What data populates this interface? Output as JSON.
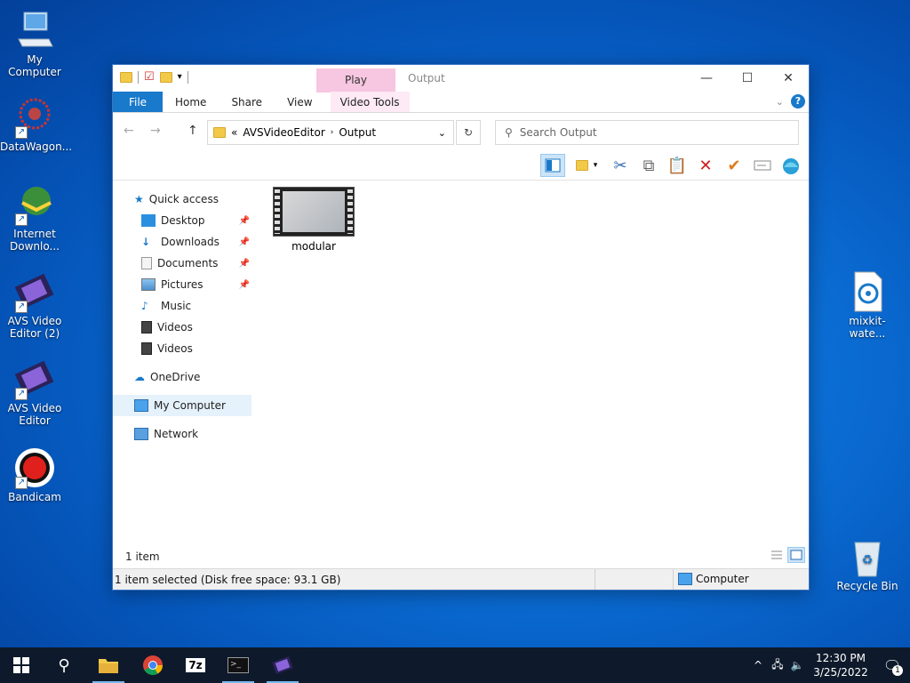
{
  "desktop": {
    "icons": [
      {
        "label": "My Computer"
      },
      {
        "label": "DataWagon..."
      },
      {
        "label": "Internet Downlo..."
      },
      {
        "label": "AVS Video Editor (2)"
      },
      {
        "label": "AVS Video Editor"
      },
      {
        "label": "Bandicam"
      },
      {
        "label": "mixkit-wate..."
      },
      {
        "label": "Recycle Bin"
      }
    ]
  },
  "window": {
    "title": "Output",
    "context_tab": "Play",
    "tabs": {
      "file": "File",
      "home": "Home",
      "share": "Share",
      "view": "View",
      "video_tools": "Video Tools"
    },
    "help": "?",
    "address": {
      "chevrons": "«",
      "crumbs": [
        "AVSVideoEditor",
        "Output"
      ]
    },
    "search_placeholder": "Search Output",
    "nav": {
      "quick_access": "Quick access",
      "desktop": "Desktop",
      "downloads": "Downloads",
      "documents": "Documents",
      "pictures": "Pictures",
      "music": "Music",
      "videos1": "Videos",
      "videos2": "Videos",
      "onedrive": "OneDrive",
      "my_computer": "My Computer",
      "network": "Network"
    },
    "files": [
      {
        "name": "modular"
      }
    ],
    "item_count": "1 item",
    "status": {
      "selection": "1 item selected (Disk free space: 93.1 GB)",
      "location": "Computer"
    }
  },
  "taskbar": {
    "time": "12:30 PM",
    "date": "3/25/2022",
    "notifications": "1"
  },
  "colors": {
    "accent": "#1979ca",
    "context_tab": "#f7c6e0",
    "taskbar": "#0e1a2b"
  }
}
